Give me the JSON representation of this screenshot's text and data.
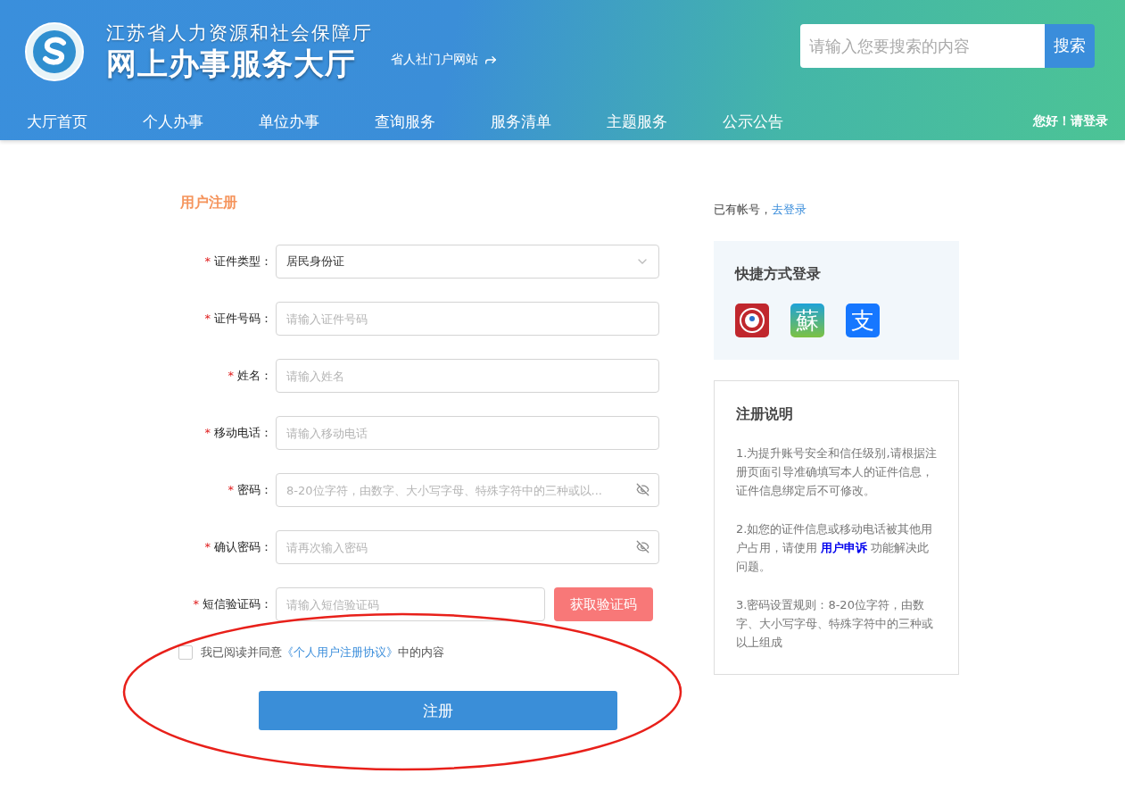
{
  "header": {
    "org": "江苏省人力资源和社会保障厅",
    "title": "网上办事服务大厅",
    "portal_link": "省人社门户网站",
    "search": {
      "placeholder": "请输入您要搜索的内容",
      "button": "搜索"
    }
  },
  "nav": {
    "items": [
      {
        "label": "大厅首页"
      },
      {
        "label": "个人办事"
      },
      {
        "label": "单位办事"
      },
      {
        "label": "查询服务"
      },
      {
        "label": "服务清单"
      },
      {
        "label": "主题服务"
      },
      {
        "label": "公示公告"
      }
    ],
    "greeting": "您好！",
    "login": "请登录"
  },
  "form": {
    "title": "用户注册",
    "required_mark": "*",
    "fields": [
      {
        "kind": "select",
        "label": "证件类型：",
        "required": true,
        "value": "居民身份证"
      },
      {
        "kind": "text",
        "label": "证件号码：",
        "required": true,
        "placeholder": "请输入证件号码"
      },
      {
        "kind": "text",
        "label": "姓名：",
        "required": true,
        "placeholder": "请输入姓名"
      },
      {
        "kind": "text",
        "label": "移动电话：",
        "required": true,
        "placeholder": "请输入移动电话"
      },
      {
        "kind": "password",
        "label": "密码：",
        "required": true,
        "placeholder": "8-20位字符，由数字、大小写字母、特殊字符中的三种或以..."
      },
      {
        "kind": "password",
        "label": "确认密码：",
        "required": true,
        "placeholder": "请再次输入密码"
      },
      {
        "kind": "sms",
        "label": "短信验证码：",
        "required": true,
        "placeholder": "请输入短信验证码",
        "button": "获取验证码"
      }
    ],
    "agreement": {
      "checked": false,
      "before": "我已阅读并同意",
      "link": "《个人用户注册协议》",
      "after": "中的内容"
    },
    "submit": "注册"
  },
  "side": {
    "have_account": "已有帐号，",
    "login_link": "去登录",
    "quick_login": {
      "title": "快捷方式登录",
      "items": [
        {
          "kind": "emblem"
        },
        {
          "kind": "su",
          "glyph": "蘇"
        },
        {
          "kind": "alipay",
          "glyph": "支"
        }
      ]
    },
    "notes": {
      "title": "注册说明",
      "items": [
        {
          "text": "1.为提升账号安全和信任级别,请根据注册页面引导准确填写本人的证件信息，证件信息绑定后不可修改。"
        },
        {
          "text": "2.如您的证件信息或移动电话被其他用户占用，请使用",
          "link": "用户申诉",
          "after": "功能解决此问题。"
        },
        {
          "text": "3.密码设置规则：8-20位字符，由数字、大小写字母、特殊字符中的三种或以上组成"
        }
      ]
    }
  }
}
